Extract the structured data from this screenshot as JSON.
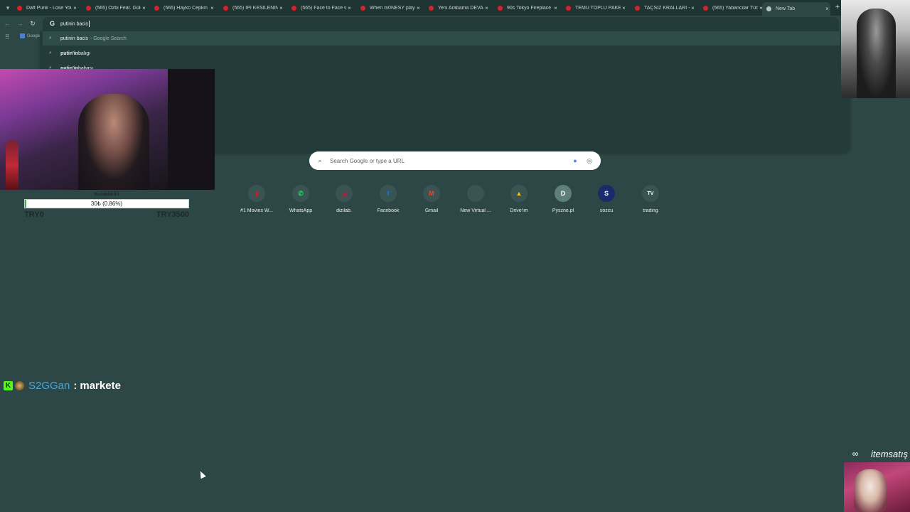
{
  "tabs": [
    {
      "title": "Daft Punk - Lose Yourself",
      "favicon": "youtube-icon"
    },
    {
      "title": "(565) Ozbi Feat. Gülce",
      "favicon": "youtube-icon"
    },
    {
      "title": "(565) Hayko Cepkin",
      "favicon": "youtube-icon"
    },
    {
      "title": "(565) İPİ KESİLENİN AI",
      "favicon": "youtube-icon"
    },
    {
      "title": "(565) Face to Face with",
      "favicon": "youtube-icon"
    },
    {
      "title": "When m0NESY plays",
      "favicon": "youtube-icon"
    },
    {
      "title": "Yeni Arabama DEVASA",
      "favicon": "youtube-icon"
    },
    {
      "title": "90s Tokyo Fireplace D",
      "favicon": "youtube-icon"
    },
    {
      "title": "TEMU TOPLU PAKET A",
      "favicon": "youtube-icon"
    },
    {
      "title": "TAÇSIZ KRALLARI - 20",
      "favicon": "youtube-icon"
    },
    {
      "title": "(565) Yabancılar Türk",
      "favicon": "youtube-icon"
    },
    {
      "title": "New Tab",
      "favicon": "chrome-icon",
      "active": true
    }
  ],
  "omnibox": {
    "value": "putinin bacis"
  },
  "bookmarks": {
    "first": "Google"
  },
  "suggestions": [
    {
      "bold": "putinin bacis",
      "suffix": "- Google Search"
    },
    {
      "bold": "putin'in",
      "rest": " balıgı"
    },
    {
      "bold": "putin'in",
      "rest": " babası"
    }
  ],
  "search": {
    "placeholder": "Search Google or type a URL"
  },
  "shortcuts": [
    {
      "label": "#1 Movies W...",
      "icon": "movies-icon",
      "glyph": "▮",
      "color": "#c0202a"
    },
    {
      "label": "WhatsApp",
      "icon": "whatsapp-icon",
      "glyph": "✆",
      "color": "#25d366"
    },
    {
      "label": "dizilab.",
      "icon": "dizilab-icon",
      "glyph": "◢",
      "color": "#b0203a"
    },
    {
      "label": "Facebook",
      "icon": "facebook-icon",
      "glyph": "f",
      "color": "#1877f2"
    },
    {
      "label": "Gmail",
      "icon": "gmail-icon",
      "glyph": "M",
      "color": "#ea4335"
    },
    {
      "label": "New Virtual ...",
      "icon": "virtual-icon",
      "glyph": "",
      "color": "#3a5453"
    },
    {
      "label": "Drive'ım",
      "icon": "drive-icon",
      "glyph": "▲",
      "color": "#fbbc04"
    },
    {
      "label": "Pyszne.pl",
      "icon": "pyszne-icon",
      "glyph": "D",
      "color": "#5f7f7d"
    },
    {
      "label": "sozcu",
      "icon": "sozcu-icon",
      "glyph": "S",
      "color": "#1a2a6a"
    },
    {
      "label": "trading",
      "icon": "tradingview-icon",
      "glyph": "TV",
      "color": "#111111"
    }
  ],
  "donation": {
    "goal_title": "Kulakliklill",
    "bar_text": "30₺ (0.86%)",
    "progress": 0.0086,
    "min": "TRY0",
    "max": "TRY3500"
  },
  "chat": {
    "badge": "K",
    "user": "S2GGan",
    "separator": ":",
    "message": "markete"
  },
  "sponsor": {
    "brand": "itemsatış"
  },
  "colors": {
    "background": "#2c4746",
    "tabstrip": "#1e3432",
    "progress": "#37b34a",
    "chat_user": "#4aa6d8"
  }
}
